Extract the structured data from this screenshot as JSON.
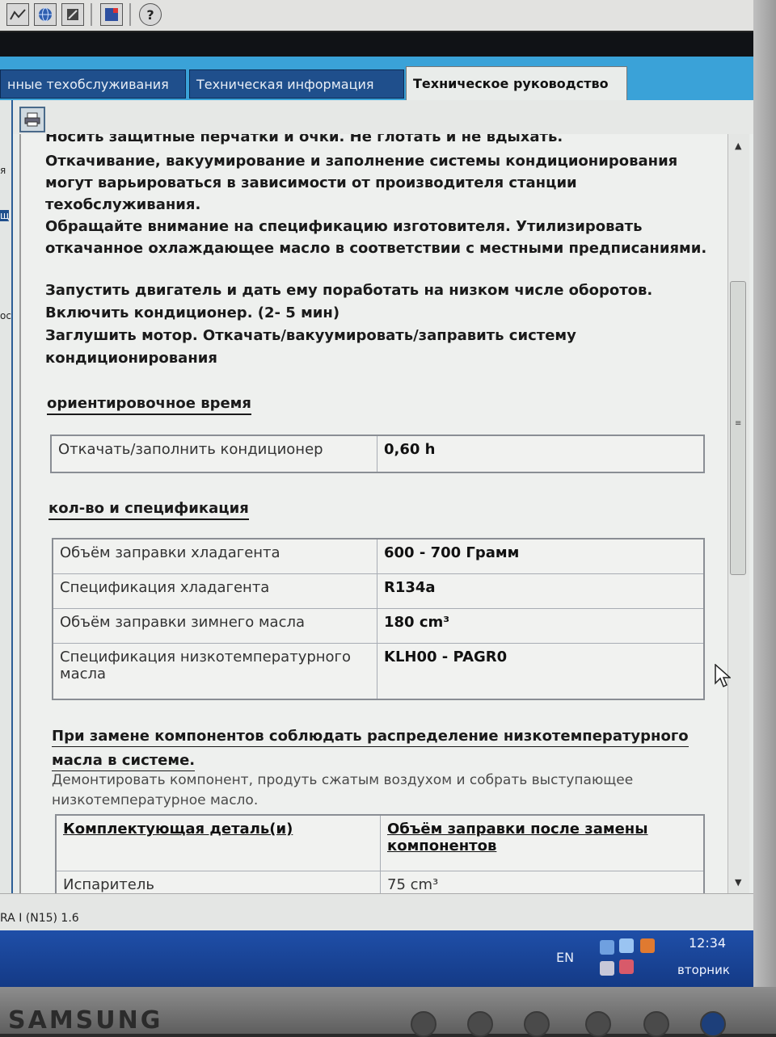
{
  "toolbar": {
    "icons": [
      "graph-icon",
      "globe-icon",
      "tools-icon",
      "flag-icon",
      "help-icon"
    ],
    "help_glyph": "?"
  },
  "tabs": [
    {
      "label": "нные техобслуживания",
      "active": false
    },
    {
      "label": "Техническая информация",
      "active": false
    },
    {
      "label": "Техническое руководство",
      "active": true
    }
  ],
  "left_strip": {
    "labels": [
      "я",
      "щ",
      "ос"
    ]
  },
  "content": {
    "cut_line": "Носить защитные перчатки и очки. Не глотать и не вдыхать.",
    "para1_l1": "Откачивание, вакуумирование и заполнение системы кондиционирования",
    "para1_l2": "могут варьироваться в зависимости от производителя станции",
    "para1_l3": "техобслуживания.",
    "para1_l4": "Обращайте внимание на спецификацию изготовителя. Утилизировать",
    "para1_l5": "откачанное охлаждающее масло в соответствии с местными предписаниями.",
    "para2_l1": "Запустить двигатель и дать ему поработать на низком числе оборотов.",
    "para2_l2": "Включить кондиционер. (2- 5 мин)",
    "para2_l3": "Заглушить мотор. Откачать/вакуумировать/заправить систему",
    "para2_l4": "кондиционирования",
    "time_heading": "ориентировочное время",
    "time_table": [
      {
        "label": "Откачать/заполнить кондиционер",
        "value": "0,60 h"
      }
    ],
    "spec_heading": "кол-во и спецификация",
    "spec_table": [
      {
        "label": "Объём заправки хладагента",
        "value": "600 - 700 Грамм"
      },
      {
        "label": "Спецификация хладагента",
        "value": "R134a"
      },
      {
        "label": "Объём заправки зимнего масла",
        "value": "180 cm³"
      },
      {
        "label": "Спецификация низкотемпературного масла",
        "value": "KLH00 - PAGR0"
      }
    ],
    "replace_heading_l1": "При замене компонентов соблюдать распределение низкотемпературного",
    "replace_heading_l2": "масла в системе.",
    "replace_text": "Демонтировать компонент, продуть сжатым воздухом и собрать выступающее низкотемпературное масло.",
    "components_table": {
      "headers": [
        "Комплектующая деталь(и)",
        "Объём заправки после замены компонентов"
      ],
      "rows": [
        {
          "part": "Испаритель",
          "volume": "75 cm³"
        }
      ]
    }
  },
  "statusbar": {
    "text": "RA I (N15) 1.6"
  },
  "taskbar": {
    "language": "EN",
    "time": "12:34",
    "day": "вторник"
  },
  "monitor": {
    "brand": "SAMSUNG"
  }
}
